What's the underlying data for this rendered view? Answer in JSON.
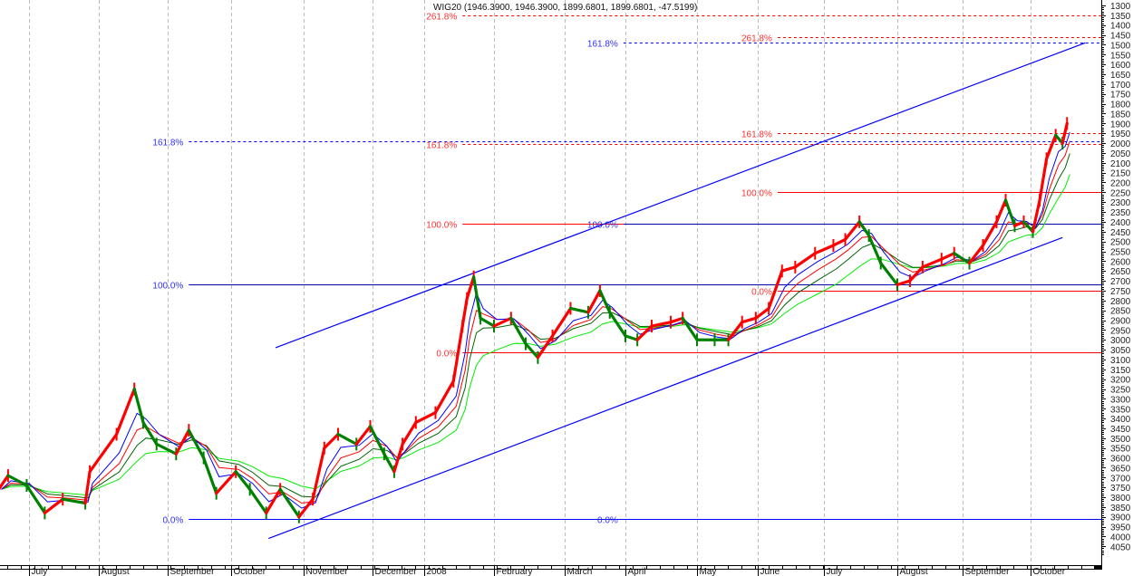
{
  "chart_data": {
    "type": "line",
    "title": "WIG20 (1946.3900, 1946.3900, 1899.6801, 1899.6801, -47.5199)",
    "y_axis": {
      "range": [
        1300,
        4050
      ],
      "inverted": true,
      "position": "right",
      "ticks": [
        1300,
        1350,
        1400,
        1450,
        1500,
        1550,
        1600,
        1650,
        1700,
        1750,
        1800,
        1850,
        1900,
        1950,
        2000,
        2050,
        2100,
        2150,
        2200,
        2250,
        2300,
        2350,
        2400,
        2450,
        2500,
        2550,
        2600,
        2650,
        2700,
        2750,
        2800,
        2850,
        2900,
        2950,
        3000,
        3050,
        3100,
        3150,
        3200,
        3250,
        3300,
        3350,
        3400,
        3450,
        3500,
        3550,
        3600,
        3650,
        3700,
        3750,
        3800,
        3850,
        3900,
        3950,
        4000,
        4050
      ]
    },
    "x_axis": {
      "labels": [
        {
          "label": "July",
          "date": "2007-07-01"
        },
        {
          "label": "August",
          "date": "2007-08-01"
        },
        {
          "label": "September",
          "date": "2007-09-01"
        },
        {
          "label": "October",
          "date": "2007-10-01"
        },
        {
          "label": "November",
          "date": "2007-11-01"
        },
        {
          "label": "December",
          "date": "2007-12-01"
        },
        {
          "label": "2008",
          "date": "2008-01-01"
        },
        {
          "label": "February",
          "date": "2008-02-01"
        },
        {
          "label": "March",
          "date": "2008-03-01"
        },
        {
          "label": "April",
          "date": "2008-04-01"
        },
        {
          "label": "May",
          "date": "2008-05-01"
        },
        {
          "label": "June",
          "date": "2008-06-01"
        },
        {
          "label": "July",
          "date": "2008-07-01"
        },
        {
          "label": "August",
          "date": "2008-08-01"
        },
        {
          "label": "September",
          "date": "2008-09-01"
        },
        {
          "label": "October",
          "date": "2008-10-01"
        }
      ]
    },
    "grid": {
      "vertical": true,
      "horizontal": false
    },
    "colors": {
      "up": "#ff0000",
      "down": "#008000",
      "ma_fast": "#0000ff",
      "ma_mid": "#ff0000",
      "ma_slow": "#006400",
      "ma_long": "#00ee00",
      "fib_blue": "#0000ff",
      "fib_red": "#ff0000"
    },
    "series": [
      {
        "values": [
          {
            "date": "2007-06-18",
            "close": 3760
          },
          {
            "date": "2007-06-22",
            "close": 3690
          },
          {
            "date": "2007-06-30",
            "close": 3740
          },
          {
            "date": "2007-07-08",
            "close": 3880
          },
          {
            "date": "2007-07-16",
            "close": 3810
          },
          {
            "date": "2007-07-26",
            "close": 3830
          },
          {
            "date": "2007-07-28",
            "close": 3670
          },
          {
            "date": "2007-08-09",
            "close": 3480
          },
          {
            "date": "2007-08-17",
            "close": 3250
          },
          {
            "date": "2007-08-21",
            "close": 3420
          },
          {
            "date": "2007-08-27",
            "close": 3530
          },
          {
            "date": "2007-09-05",
            "close": 3580
          },
          {
            "date": "2007-09-11",
            "close": 3460
          },
          {
            "date": "2007-09-18",
            "close": 3600
          },
          {
            "date": "2007-09-24",
            "close": 3780
          },
          {
            "date": "2007-10-03",
            "close": 3670
          },
          {
            "date": "2007-10-09",
            "close": 3760
          },
          {
            "date": "2007-10-16",
            "close": 3880
          },
          {
            "date": "2007-10-22",
            "close": 3760
          },
          {
            "date": "2007-10-30",
            "close": 3900
          },
          {
            "date": "2007-11-05",
            "close": 3810
          },
          {
            "date": "2007-11-10",
            "close": 3550
          },
          {
            "date": "2007-11-16",
            "close": 3480
          },
          {
            "date": "2007-11-24",
            "close": 3530
          },
          {
            "date": "2007-11-30",
            "close": 3440
          },
          {
            "date": "2007-12-08",
            "close": 3580
          },
          {
            "date": "2007-12-14",
            "close": 3670
          },
          {
            "date": "2007-12-19",
            "close": 3530
          },
          {
            "date": "2007-12-27",
            "close": 3420
          },
          {
            "date": "2008-01-06",
            "close": 3370
          },
          {
            "date": "2008-01-14",
            "close": 3210
          },
          {
            "date": "2008-01-18",
            "close": 2930
          },
          {
            "date": "2008-01-20",
            "close": 2790
          },
          {
            "date": "2008-01-23",
            "close": 2680
          },
          {
            "date": "2008-01-26",
            "close": 2890
          },
          {
            "date": "2008-02-01",
            "close": 2930
          },
          {
            "date": "2008-02-08",
            "close": 2890
          },
          {
            "date": "2008-02-14",
            "close": 3020
          },
          {
            "date": "2008-02-19",
            "close": 3090
          },
          {
            "date": "2008-02-25",
            "close": 2980
          },
          {
            "date": "2008-03-04",
            "close": 2840
          },
          {
            "date": "2008-03-13",
            "close": 2860
          },
          {
            "date": "2008-03-19",
            "close": 2750
          },
          {
            "date": "2008-03-24",
            "close": 2860
          },
          {
            "date": "2008-04-01",
            "close": 2980
          },
          {
            "date": "2008-04-06",
            "close": 3000
          },
          {
            "date": "2008-04-12",
            "close": 2930
          },
          {
            "date": "2008-04-20",
            "close": 2910
          },
          {
            "date": "2008-04-25",
            "close": 2890
          },
          {
            "date": "2008-05-01",
            "close": 3000
          },
          {
            "date": "2008-05-10",
            "close": 3000
          },
          {
            "date": "2008-05-17",
            "close": 3000
          },
          {
            "date": "2008-05-24",
            "close": 2910
          },
          {
            "date": "2008-05-31",
            "close": 2890
          },
          {
            "date": "2008-06-06",
            "close": 2840
          },
          {
            "date": "2008-06-12",
            "close": 2650
          },
          {
            "date": "2008-06-18",
            "close": 2630
          },
          {
            "date": "2008-06-27",
            "close": 2560
          },
          {
            "date": "2008-07-05",
            "close": 2520
          },
          {
            "date": "2008-07-10",
            "close": 2490
          },
          {
            "date": "2008-07-16",
            "close": 2400
          },
          {
            "date": "2008-07-20",
            "close": 2470
          },
          {
            "date": "2008-07-25",
            "close": 2610
          },
          {
            "date": "2008-08-01",
            "close": 2720
          },
          {
            "date": "2008-08-07",
            "close": 2700
          },
          {
            "date": "2008-08-13",
            "close": 2630
          },
          {
            "date": "2008-08-22",
            "close": 2590
          },
          {
            "date": "2008-08-28",
            "close": 2560
          },
          {
            "date": "2008-09-04",
            "close": 2610
          },
          {
            "date": "2008-09-10",
            "close": 2520
          },
          {
            "date": "2008-09-16",
            "close": 2400
          },
          {
            "date": "2008-09-20",
            "close": 2290
          },
          {
            "date": "2008-09-24",
            "close": 2420
          },
          {
            "date": "2008-09-28",
            "close": 2400
          },
          {
            "date": "2008-10-02",
            "close": 2450
          },
          {
            "date": "2008-10-05",
            "close": 2290
          },
          {
            "date": "2008-10-08",
            "close": 2080
          },
          {
            "date": "2008-10-12",
            "close": 1960
          },
          {
            "date": "2008-10-15",
            "close": 2000
          },
          {
            "date": "2008-10-17",
            "close": 1899.68
          }
        ]
      }
    ],
    "fib_levels": [
      {
        "label": "161.8%",
        "value": 1990,
        "color": "#0000ff",
        "style": "dashed",
        "from": "2007-09-11"
      },
      {
        "label": "100.0%",
        "value": 2720,
        "color": "#0000aa",
        "style": "solid",
        "from": "2007-09-11"
      },
      {
        "label": "0.0%",
        "value": 3910,
        "color": "#0000ff",
        "style": "solid",
        "from": "2007-09-11"
      },
      {
        "label": "261.8%",
        "value": 1350,
        "color": "#ff0000",
        "style": "dashed",
        "from": "2008-01-18"
      },
      {
        "label": "161.8%",
        "value": 2005,
        "color": "#ff0000",
        "style": "dashed",
        "from": "2008-01-18"
      },
      {
        "label": "100.0%",
        "value": 2410,
        "color": "#ff0000",
        "style": "solid",
        "from": "2008-01-18"
      },
      {
        "label": "0.0%",
        "value": 3065,
        "color": "#ff0000",
        "style": "solid",
        "from": "2008-01-18"
      },
      {
        "label": "161.8%",
        "value": 1490,
        "color": "#0000ff",
        "style": "dashed",
        "from": "2008-03-31"
      },
      {
        "label": "100.0%",
        "value": 2410,
        "color": "#0000aa",
        "style": "solid",
        "from": "2008-03-31"
      },
      {
        "label": "0.0%",
        "value": 3910,
        "color": "#0000ff",
        "style": "solid",
        "from": "2008-03-31"
      },
      {
        "label": "261.8%",
        "value": 1460,
        "color": "#ff0000",
        "style": "dashed",
        "from": "2008-06-10"
      },
      {
        "label": "161.8%",
        "value": 1950,
        "color": "#ff0000",
        "style": "dashed",
        "from": "2008-06-10"
      },
      {
        "label": "100.0%",
        "value": 2250,
        "color": "#ff0000",
        "style": "solid",
        "from": "2008-06-10"
      },
      {
        "label": "0.0%",
        "value": 2750,
        "color": "#ff0000",
        "style": "solid",
        "from": "2008-06-10"
      }
    ],
    "trend_lines": [
      {
        "from": {
          "date": "2007-10-20",
          "value": 3040
        },
        "to": {
          "date": "2008-10-25",
          "value": 1490
        },
        "color": "#0000ff"
      },
      {
        "from": {
          "date": "2007-10-17",
          "value": 4010
        },
        "to": {
          "date": "2008-10-15",
          "value": 2480
        },
        "color": "#0000ff"
      }
    ]
  }
}
